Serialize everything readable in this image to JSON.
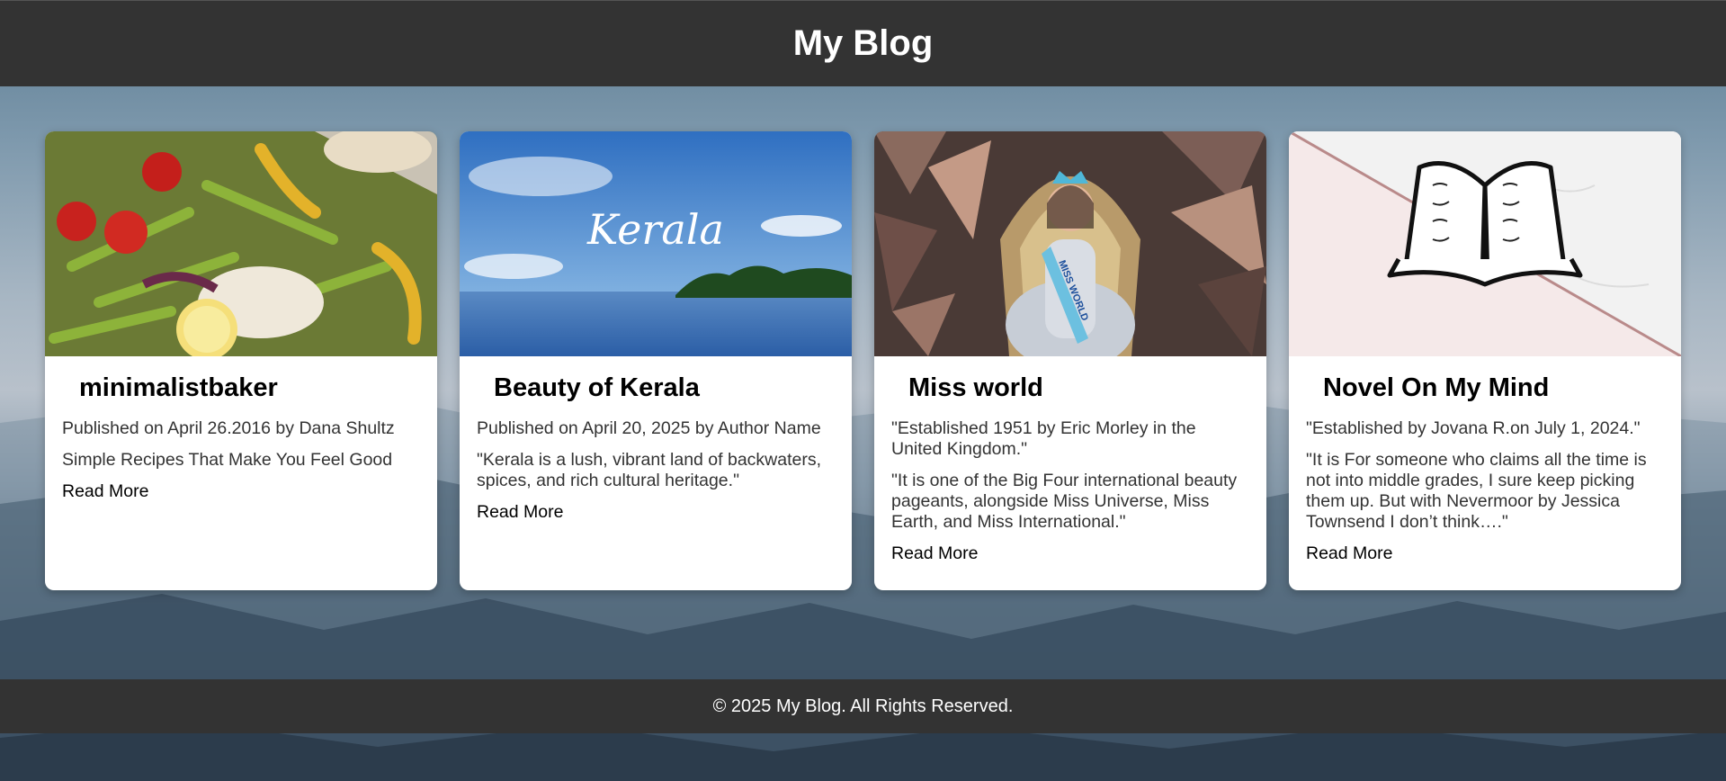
{
  "header": {
    "title": "My Blog"
  },
  "posts": [
    {
      "title": "minimalistbaker",
      "meta": "Published on April 26.2016 by Dana Shultz",
      "description": "Simple Recipes That Make You Feel Good",
      "read_more": "Read More",
      "image": "roasted-vegetables-photo"
    },
    {
      "title": "Beauty of Kerala",
      "meta": "Published on April 20, 2025 by Author Name",
      "description": "\"Kerala is a lush, vibrant land of backwaters, spices, and rich cultural heritage.\"",
      "read_more": "Read More",
      "image": "kerala-backwaters-photo",
      "image_text": "Kerala"
    },
    {
      "title": "Miss world",
      "meta": "\"Established 1951 by Eric Morley in the United Kingdom.\"",
      "description": "\"It is one of the Big Four international beauty pageants, alongside Miss Universe, Miss Earth, and Miss International.\"",
      "read_more": "Read More",
      "image": "miss-world-winner-photo",
      "image_text": "MISS WORLD"
    },
    {
      "title": "Novel On My Mind",
      "meta": "\"Established by Jovana R.on July 1, 2024.\"",
      "description": "\"It is For someone who claims all the time is not into middle grades, I sure keep picking them up. But with Nevermoor by Jessica Townsend I don’t think….\"",
      "read_more": "Read More",
      "image": "open-book-illustration"
    }
  ],
  "footer": {
    "text": "© 2025 My Blog. All Rights Reserved."
  },
  "colors": {
    "bar": "#333333",
    "card": "#ffffff"
  }
}
